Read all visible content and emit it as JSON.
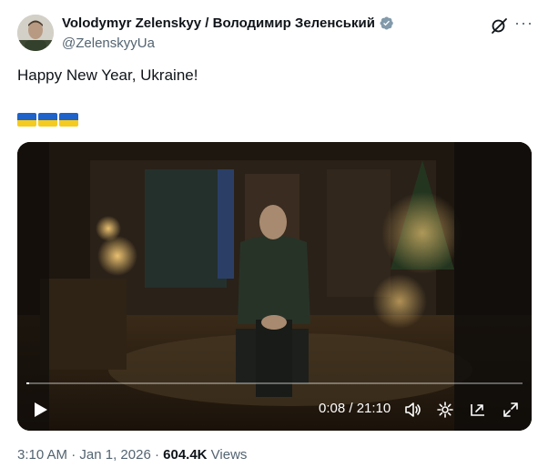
{
  "author": {
    "name": "Volodymyr Zelenskyy / Володимир Зеленський",
    "handle": "@ZelenskyyUa",
    "verified_color": "#829aab"
  },
  "icons": {
    "header_actions": [
      "grok-icon",
      "more-icon"
    ],
    "player_controls": [
      "play-icon",
      "volume-icon",
      "settings-icon",
      "pip-icon",
      "fullscreen-icon"
    ]
  },
  "tweet": {
    "text": "Happy New Year, Ukraine!",
    "emoji_flags": [
      "ukraine-flag",
      "ukraine-flag",
      "ukraine-flag"
    ]
  },
  "video": {
    "time_display": "0:08 / 21:10",
    "progress": 0.0063
  },
  "meta": {
    "time": "3:10 AM",
    "separator": " · ",
    "date": "Jan 1, 2026",
    "views_count": "604.4K",
    "views_label": " Views"
  }
}
